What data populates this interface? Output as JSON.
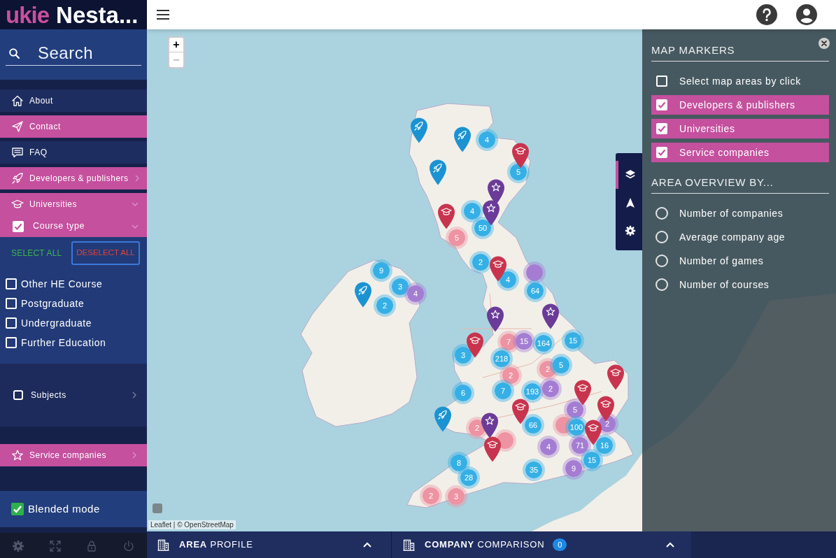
{
  "logo": {
    "brand": "ukie",
    "title": "Nesta..."
  },
  "search": {
    "placeholder": "Search"
  },
  "menu": [
    {
      "label": "About",
      "selected": false
    },
    {
      "label": "Contact",
      "selected": true
    },
    {
      "label": "FAQ",
      "selected": false
    },
    {
      "label": "Developers & publishers",
      "selected": true,
      "expanded": false
    },
    {
      "label": "Universities",
      "selected": true,
      "expanded": true,
      "filters": [
        {
          "label": "Course type",
          "checked": true,
          "expanded": true,
          "select_all": "SELECT ALL",
          "deselect_all": "DESELECT ALL",
          "options": [
            {
              "label": "Other HE Course",
              "checked": false
            },
            {
              "label": "Postgraduate",
              "checked": false
            },
            {
              "label": "Undergraduate",
              "checked": false
            },
            {
              "label": "Further Education",
              "checked": false
            }
          ]
        },
        {
          "label": "Subjects",
          "checked": false,
          "expanded": false
        }
      ]
    },
    {
      "label": "Service companies",
      "selected": true,
      "expanded": false
    }
  ],
  "blended_mode": {
    "label": "Blended mode",
    "checked": true
  },
  "map": {
    "zoom_in": {
      "label": "+",
      "disabled": false
    },
    "zoom_out": {
      "label": "−",
      "disabled": true
    },
    "attribution": "Leaflet | © OpenStreetMap",
    "markers": [
      {
        "kind": "developer",
        "color": "#1b93d2"
      },
      {
        "kind": "developer",
        "color": "#1b93d2"
      },
      {
        "kind": "cluster",
        "color": "#35b0e6",
        "text": "4"
      },
      {
        "kind": "university",
        "color": "#c8344e"
      },
      {
        "kind": "developer",
        "color": "#1b93d2"
      },
      {
        "kind": "cluster",
        "color": "#35b0e6",
        "text": "5"
      },
      {
        "kind": "service",
        "color": "#6b3b98"
      },
      {
        "kind": "university",
        "color": "#c8344e"
      },
      {
        "kind": "cluster",
        "color": "#35b0e6",
        "text": "4"
      },
      {
        "kind": "service",
        "color": "#6b3b98"
      },
      {
        "kind": "cluster",
        "color": "#ee93a2",
        "text": "5"
      },
      {
        "kind": "cluster",
        "color": "#35b0e6",
        "text": "50"
      },
      {
        "kind": "developer",
        "color": "#1b93d2"
      },
      {
        "kind": "cluster",
        "color": "#35b0e6",
        "text": "9"
      },
      {
        "kind": "cluster",
        "color": "#35b0e6",
        "text": "3"
      },
      {
        "kind": "cluster",
        "color": "#a47dd3",
        "text": "4"
      },
      {
        "kind": "cluster",
        "color": "#35b0e6",
        "text": "2"
      },
      {
        "kind": "university",
        "color": "#c8344e"
      },
      {
        "kind": "cluster",
        "color": "#35b0e6",
        "text": "4"
      },
      {
        "kind": "cluster",
        "color": "#a47dd3"
      },
      {
        "kind": "cluster",
        "color": "#35b0e6",
        "text": "64"
      },
      {
        "kind": "cluster",
        "color": "#35b0e6",
        "text": "2"
      },
      {
        "kind": "service",
        "color": "#6b3b98"
      },
      {
        "kind": "service",
        "color": "#6b3b98"
      },
      {
        "kind": "university",
        "color": "#c8344e"
      },
      {
        "kind": "cluster",
        "color": "#ee93a2",
        "text": "7"
      },
      {
        "kind": "cluster",
        "color": "#a47dd3",
        "text": "15"
      },
      {
        "kind": "cluster",
        "color": "#35b0e6",
        "text": "164"
      },
      {
        "kind": "cluster",
        "color": "#35b0e6",
        "text": "15"
      },
      {
        "kind": "cluster",
        "color": "#35b0e6",
        "text": "3"
      },
      {
        "kind": "cluster",
        "color": "#35b0e6",
        "text": "218"
      },
      {
        "kind": "cluster",
        "color": "#ee93a2",
        "text": "2"
      },
      {
        "kind": "cluster",
        "color": "#ee93a2",
        "text": "2"
      },
      {
        "kind": "cluster",
        "color": "#35b0e6",
        "text": "5"
      },
      {
        "kind": "university",
        "color": "#c8344e"
      },
      {
        "kind": "cluster",
        "color": "#35b0e6",
        "text": "6"
      },
      {
        "kind": "cluster",
        "color": "#35b0e6",
        "text": "7"
      },
      {
        "kind": "cluster",
        "color": "#35b0e6",
        "text": "193"
      },
      {
        "kind": "cluster",
        "color": "#a47dd3",
        "text": "2"
      },
      {
        "kind": "university",
        "color": "#c8344e"
      },
      {
        "kind": "developer",
        "color": "#1b93d2"
      },
      {
        "kind": "university",
        "color": "#c8344e"
      },
      {
        "kind": "cluster",
        "color": "#a47dd3",
        "text": "5"
      },
      {
        "kind": "university",
        "color": "#c8344e"
      },
      {
        "kind": "cluster",
        "color": "#ee93a2",
        "text": "2"
      },
      {
        "kind": "service",
        "color": "#6b3b98"
      },
      {
        "kind": "cluster",
        "color": "#35b0e6",
        "text": "66"
      },
      {
        "kind": "cluster",
        "color": "#ee93a2"
      },
      {
        "kind": "cluster",
        "color": "#35b0e6",
        "text": "100"
      },
      {
        "kind": "university",
        "color": "#c8344e"
      },
      {
        "kind": "cluster",
        "color": "#a47dd3",
        "text": "2"
      },
      {
        "kind": "university",
        "color": "#c8344e"
      },
      {
        "kind": "cluster",
        "color": "#ee93a2"
      },
      {
        "kind": "cluster",
        "color": "#a47dd3",
        "text": "4"
      },
      {
        "kind": "cluster",
        "color": "#a47dd3",
        "text": "71"
      },
      {
        "kind": "cluster",
        "color": "#35b0e6",
        "text": "16"
      },
      {
        "kind": "cluster",
        "color": "#35b0e6",
        "text": "8"
      },
      {
        "kind": "cluster",
        "color": "#35b0e6",
        "text": "35"
      },
      {
        "kind": "cluster",
        "color": "#a47dd3",
        "text": "9"
      },
      {
        "kind": "cluster",
        "color": "#35b0e6",
        "text": "15"
      },
      {
        "kind": "cluster",
        "color": "#35b0e6",
        "text": "28"
      },
      {
        "kind": "cluster",
        "color": "#ee93a2",
        "text": "2"
      },
      {
        "kind": "cluster",
        "color": "#ee93a2",
        "text": "3"
      }
    ]
  },
  "side_tabs": [
    {
      "selected": true
    },
    {
      "selected": false
    },
    {
      "selected": false
    }
  ],
  "panel": {
    "sections": [
      {
        "kind": "checkbox",
        "title": "MAP MARKERS",
        "options": [
          {
            "label": "Select map areas by click",
            "checked": false
          },
          {
            "label": "Developers & publishers",
            "checked": true
          },
          {
            "label": "Universities",
            "checked": true
          },
          {
            "label": "Service companies",
            "checked": true
          }
        ]
      },
      {
        "kind": "radio",
        "title": "AREA OVERVIEW BY...",
        "options": [
          {
            "label": "Number of companies",
            "selected": false
          },
          {
            "label": "Average company age",
            "selected": false
          },
          {
            "label": "Number of games",
            "selected": false
          },
          {
            "label": "Number of courses",
            "selected": false
          }
        ]
      }
    ]
  },
  "bottom_bar": [
    {
      "title": "**AREA** PROFILE",
      "expanded": false
    },
    {
      "title": "**COMPANY** COMPARISON",
      "badge": "0",
      "expanded": false
    }
  ]
}
